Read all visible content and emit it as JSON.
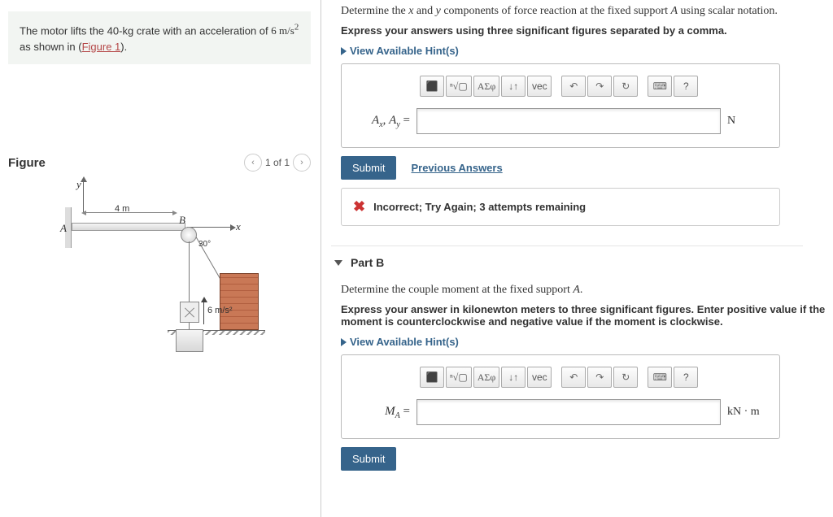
{
  "intro": {
    "text_before": "The motor lifts the 40-kg crate with an acceleration of ",
    "accel_value": "6 m/s",
    "accel_exp": "2",
    "text_mid": " as shown in (",
    "figure_link": "Figure 1",
    "text_after": ")."
  },
  "figure": {
    "title": "Figure",
    "pager": "1 of 1",
    "dim_4m": "4 m",
    "label_A": "A",
    "label_B": "B",
    "label_x": "x",
    "label_y": "y",
    "angle": "30°",
    "accel": "6 m/s²"
  },
  "partA": {
    "question_pre": "Determine the ",
    "var1": "x",
    "question_mid1": " and ",
    "var2": "y",
    "question_mid2": " components of force reaction at the fixed support ",
    "var3": "A",
    "question_post": " using scalar notation.",
    "instruct": "Express your answers using three significant figures separated by a comma.",
    "hints": "View Available Hint(s)",
    "label_html": "A_x, A_y =",
    "unit": "N",
    "submit": "Submit",
    "prev": "Previous Answers",
    "feedback": "Incorrect; Try Again; 3 attempts remaining"
  },
  "partB": {
    "header": "Part B",
    "question_pre": "Determine the couple moment at the fixed support ",
    "var1": "A",
    "question_post": ".",
    "instruct": "Express your answer in kilonewton meters to three significant figures. Enter positive value if the moment is counterclockwise and negative value if the moment is clockwise.",
    "hints": "View Available Hint(s)",
    "label_html": "M_A =",
    "unit": "kN · m",
    "submit": "Submit"
  },
  "toolbar": {
    "templates": "⬛",
    "sqrt": "ⁿ√▢",
    "greek": "ΑΣφ",
    "subsup": "↓↑",
    "vec": "vec",
    "undo": "↶",
    "redo": "↷",
    "reset": "↻",
    "keyboard": "⌨",
    "help": "?"
  }
}
